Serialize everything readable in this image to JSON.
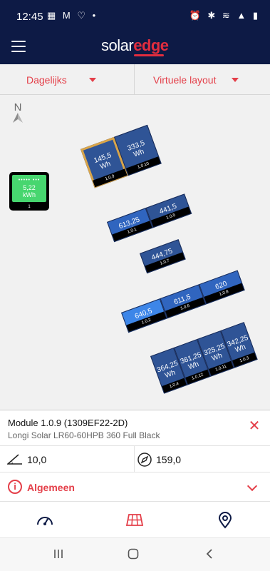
{
  "status_bar": {
    "time": "12:45",
    "left_icons": "▦ M ♡ •",
    "right_icons": "⏰ ✱ ≋ ▲ ▮"
  },
  "header": {
    "menu_icon": "hamburger-menu-icon",
    "logo_solar": "solar",
    "logo_edge": "edge"
  },
  "filters": {
    "period": "Dagelijks",
    "layout": "Virtuele layout"
  },
  "map": {
    "compass_label": "N",
    "inverter": {
      "energy": "5,22",
      "unit": "kWh",
      "id": "1",
      "dots": "••••• •••"
    },
    "groups": [
      {
        "panels": [
          {
            "energy": "145,5",
            "unit": "Wh",
            "id": "1.0.9",
            "selected": true
          },
          {
            "energy": "333,5",
            "unit": "Wh",
            "id": "1.0.10",
            "selected": false
          }
        ]
      },
      {
        "panels": [
          {
            "energy": "613,25",
            "unit": "Wh",
            "id": "1.0.1"
          },
          {
            "energy": "441,5",
            "unit": "Wh",
            "id": "1.0.5"
          }
        ]
      },
      {
        "panels": [
          {
            "energy": "444,75",
            "unit": "Wh",
            "id": "1.0.7"
          }
        ]
      },
      {
        "panels": [
          {
            "energy": "640,5",
            "unit": "Wh",
            "id": "1.0.2"
          },
          {
            "energy": "611,5",
            "unit": "Wh",
            "id": "1.0.6"
          },
          {
            "energy": "620",
            "unit": "Wh",
            "id": "1.0.8"
          }
        ]
      },
      {
        "panels": [
          {
            "energy": "364,25",
            "unit": "Wh",
            "id": "1.0.4"
          },
          {
            "energy": "361,25",
            "unit": "Wh",
            "id": "1.0.12"
          },
          {
            "energy": "325,25",
            "unit": "Wh",
            "id": "1.0.11"
          },
          {
            "energy": "342,25",
            "unit": "Wh",
            "id": "1.0.3"
          }
        ]
      }
    ]
  },
  "module_info": {
    "title": "Module 1.0.9 (1309EF22-2D)",
    "subtitle": "Longi Solar LR60-60HPB 360 Full Black",
    "tilt": "10,0",
    "azimuth": "159,0",
    "section_label": "Algemeen"
  },
  "colors": {
    "brand_navy": "#0d1a45",
    "accent_red": "#e43f49",
    "selected_outline": "#d9a54a",
    "inverter_screen": "#47d66f"
  },
  "tabs": [
    "dashboard-gauge-icon",
    "solar-layout-grid-icon",
    "location-pin-icon"
  ],
  "android_nav": [
    "recents-icon",
    "home-icon",
    "back-icon"
  ]
}
